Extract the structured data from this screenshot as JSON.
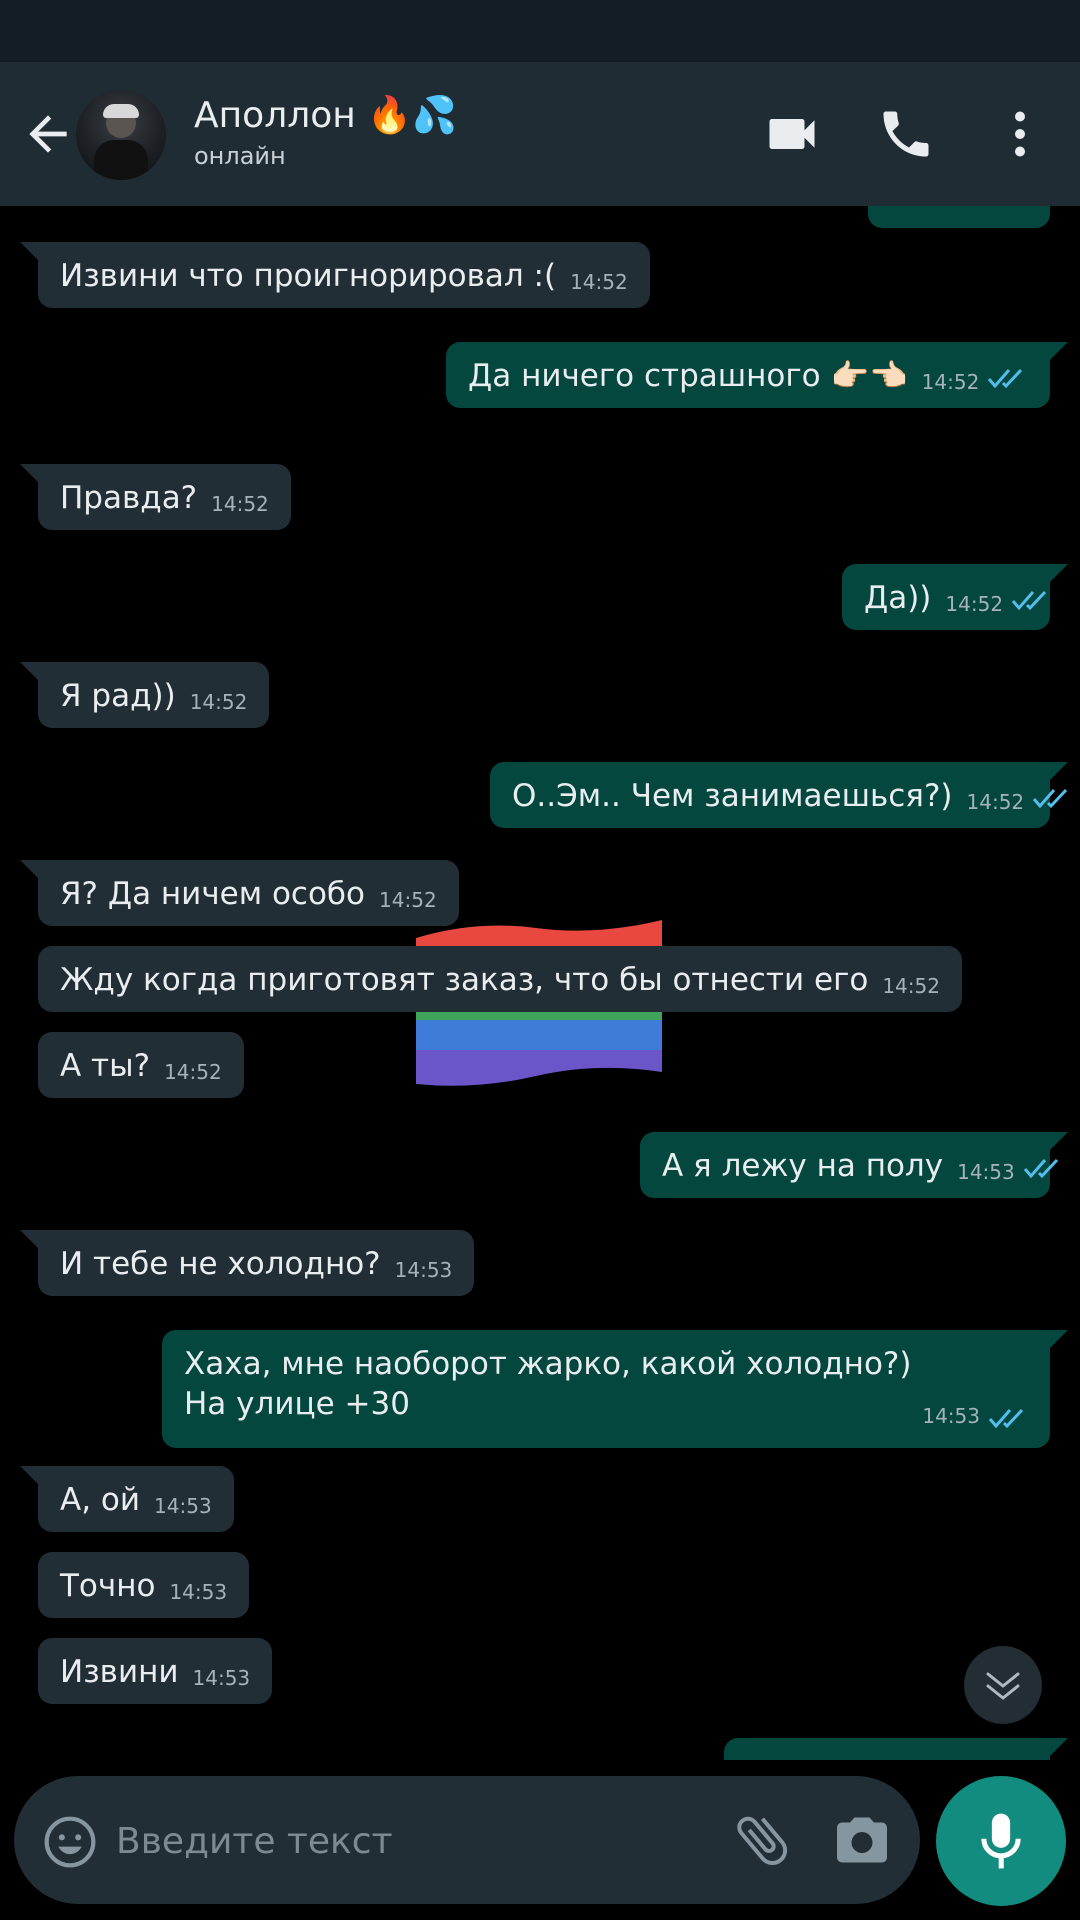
{
  "header": {
    "contact_name": "Аполлон 🔥💦",
    "contact_status": "онлайн"
  },
  "messages": [
    {
      "dir": "in",
      "text": "Извини что проигнорировал :(",
      "time": "14:52"
    },
    {
      "dir": "out",
      "text": "Да ничего страшного 👉🏻👈🏻",
      "time": "14:52",
      "read": true
    },
    {
      "dir": "in",
      "text": "Правда?",
      "time": "14:52"
    },
    {
      "dir": "out",
      "text": "Да))",
      "time": "14:52",
      "read": true
    },
    {
      "dir": "in",
      "text": "Я рад))",
      "time": "14:52"
    },
    {
      "dir": "out",
      "text": "О..Эм..  Чем занимаешься?)",
      "time": "14:52",
      "read": true
    },
    {
      "dir": "in",
      "text": "Я? Да ничем особо",
      "time": "14:52"
    },
    {
      "dir": "in",
      "text": "Жду когда приготовят заказ, что бы отнести его",
      "time": "14:52"
    },
    {
      "dir": "in",
      "text": "А ты?",
      "time": "14:52"
    },
    {
      "dir": "out",
      "text": "А я лежу на полу",
      "time": "14:53",
      "read": true
    },
    {
      "dir": "in",
      "text": "И тебе не холодно?",
      "time": "14:53"
    },
    {
      "dir": "out",
      "text_lines": [
        "Хаха, мне наоборот жарко, какой холодно?)",
        "На улице +30"
      ],
      "time": "14:53",
      "read": true
    },
    {
      "dir": "in",
      "text": "А, ой",
      "time": "14:53"
    },
    {
      "dir": "in",
      "text": "Точно",
      "time": "14:53"
    },
    {
      "dir": "in",
      "text": "Извини",
      "time": "14:53"
    }
  ],
  "composer": {
    "placeholder": "Введите текст"
  },
  "colors": {
    "background": "#000000",
    "header": "#1F2C34",
    "incoming_bubble": "#222E35",
    "outgoing_bubble": "#03473F",
    "read_ticks": "#53BDEB",
    "mic_button": "#128C7E"
  },
  "icons": [
    "back-arrow-icon",
    "video-call-icon",
    "phone-icon",
    "more-vert-icon",
    "emoji-icon",
    "attach-icon",
    "camera-icon",
    "mic-icon",
    "double-chevron-down-icon",
    "double-check-icon",
    "rainbow-flag-sticker"
  ]
}
